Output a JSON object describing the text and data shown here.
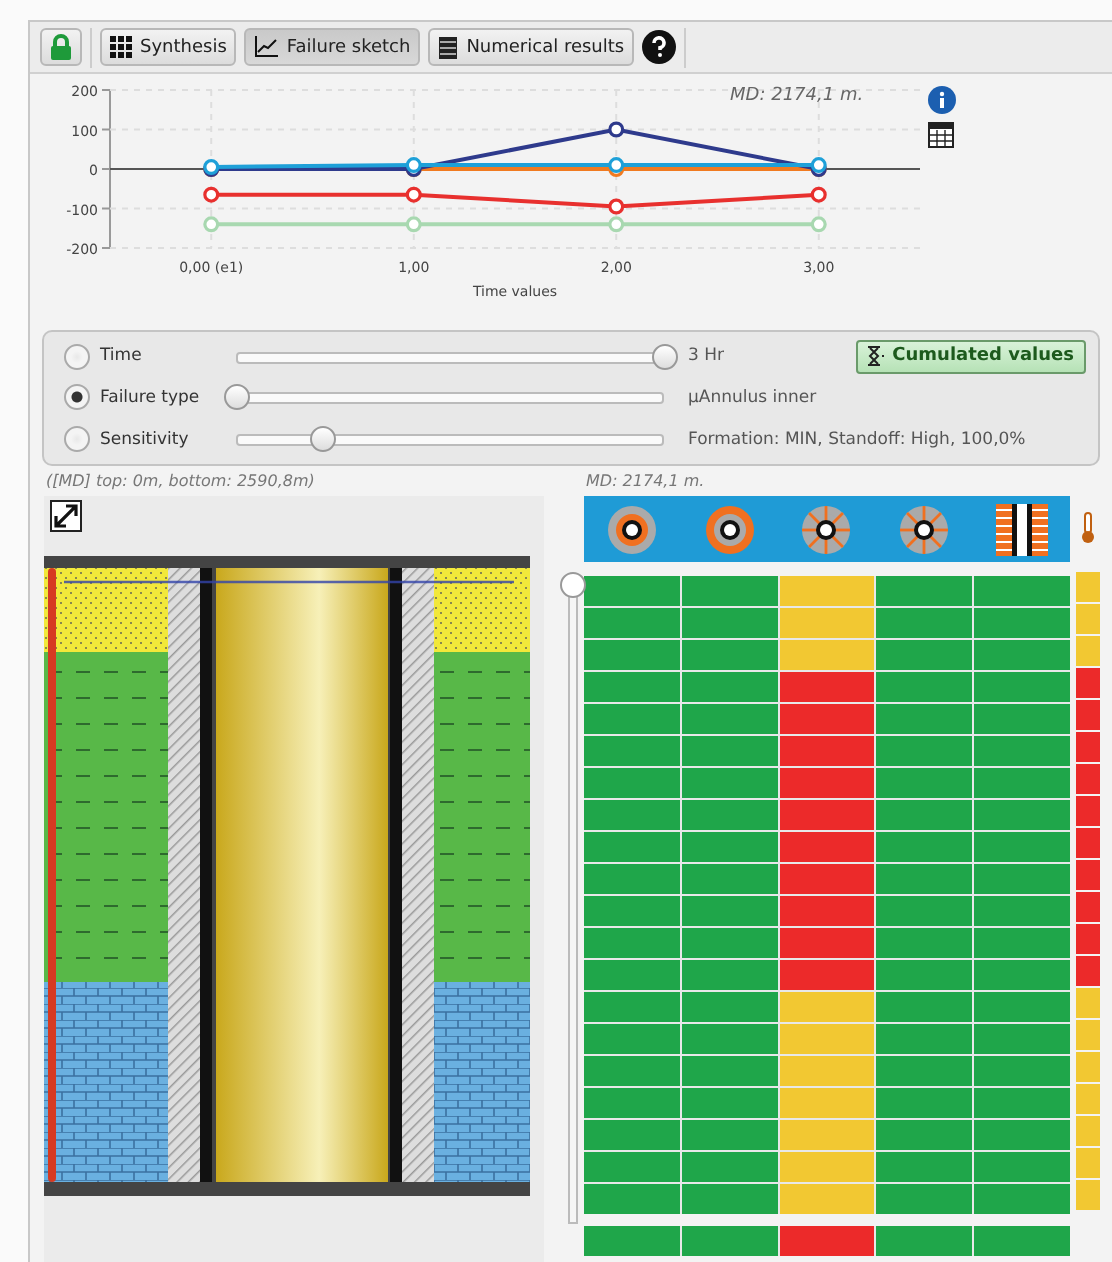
{
  "toolbar": {
    "buttons": [
      {
        "kind": "lock",
        "selected": false
      },
      {
        "kind": "grid",
        "label": "Synthesis",
        "selected": false
      },
      {
        "kind": "chart",
        "label": "Failure sketch",
        "selected": true
      },
      {
        "kind": "table",
        "label": "Numerical results",
        "selected": false
      },
      {
        "kind": "help",
        "selected": false
      }
    ]
  },
  "chart": {
    "md_label": "MD: 2174,1 m.",
    "chart_data": {
      "type": "line",
      "xlabel": "Time values",
      "x": [
        0,
        1,
        2,
        3
      ],
      "xlim": [
        -0.5,
        3.5
      ],
      "grid": true,
      "xticks": [
        {
          "value": 0,
          "label": "0,00 (e1)"
        },
        {
          "value": 1,
          "label": "1,00"
        },
        {
          "value": 2,
          "label": "2,00"
        },
        {
          "value": 3,
          "label": "3,00"
        }
      ],
      "ylim": [
        -200,
        200
      ],
      "yticks": [
        -200,
        -100,
        0,
        100,
        200
      ],
      "series": [
        {
          "color": "#a8d8b0",
          "marker": "circle",
          "values": [
            -140,
            -140,
            -140,
            -140
          ]
        },
        {
          "color": "#e8302e",
          "marker": "circle",
          "values": [
            -65,
            -65,
            -95,
            -65
          ]
        },
        {
          "color": "#f07a20",
          "marker": "circle",
          "values": [
            0,
            0,
            0,
            0
          ]
        },
        {
          "color": "#2e3a8c",
          "marker": "circle",
          "values": [
            0,
            0,
            100,
            0
          ]
        },
        {
          "color": "#1ea0d8",
          "marker": "circle",
          "values": [
            5,
            10,
            10,
            10
          ]
        }
      ]
    }
  },
  "controls": {
    "options": [
      {
        "label": "Time",
        "selected": false,
        "level": 1.0,
        "reading": "3 Hr"
      },
      {
        "label": "Failure type",
        "selected": true,
        "level": 0.0,
        "reading": "µAnnulus inner"
      },
      {
        "label": "Sensitivity",
        "selected": false,
        "level": 0.2,
        "reading": "Formation: MIN, Standoff: High, 100,0%"
      }
    ],
    "cumulated_button": "Cumulated values"
  },
  "left_caption": "([MD] top: 0m, bottom: 2590,8m)",
  "right_caption": "MD: 2174,1 m.",
  "depth_slider": {
    "level": 0.0
  },
  "grid": {
    "rows": [
      {
        "cells": [
          {
            "color": "#1fa64a"
          },
          {
            "color": "#1fa64a"
          },
          {
            "color": "#f2c832"
          },
          {
            "color": "#1fa64a"
          },
          {
            "color": "#1fa64a"
          }
        ],
        "strip": {
          "color": "#f2c832"
        }
      },
      {
        "cells": [
          {
            "color": "#1fa64a"
          },
          {
            "color": "#1fa64a"
          },
          {
            "color": "#f2c832"
          },
          {
            "color": "#1fa64a"
          },
          {
            "color": "#1fa64a"
          }
        ],
        "strip": {
          "color": "#f2c832"
        }
      },
      {
        "cells": [
          {
            "color": "#1fa64a"
          },
          {
            "color": "#1fa64a"
          },
          {
            "color": "#f2c832"
          },
          {
            "color": "#1fa64a"
          },
          {
            "color": "#1fa64a"
          }
        ],
        "strip": {
          "color": "#f2c832"
        }
      },
      {
        "cells": [
          {
            "color": "#1fa64a"
          },
          {
            "color": "#1fa64a"
          },
          {
            "color": "#ec2a2a"
          },
          {
            "color": "#1fa64a"
          },
          {
            "color": "#1fa64a"
          }
        ],
        "strip": {
          "color": "#ec2a2a"
        }
      },
      {
        "cells": [
          {
            "color": "#1fa64a"
          },
          {
            "color": "#1fa64a"
          },
          {
            "color": "#ec2a2a"
          },
          {
            "color": "#1fa64a"
          },
          {
            "color": "#1fa64a"
          }
        ],
        "strip": {
          "color": "#ec2a2a"
        }
      },
      {
        "cells": [
          {
            "color": "#1fa64a"
          },
          {
            "color": "#1fa64a"
          },
          {
            "color": "#ec2a2a"
          },
          {
            "color": "#1fa64a"
          },
          {
            "color": "#1fa64a"
          }
        ],
        "strip": {
          "color": "#ec2a2a"
        }
      },
      {
        "cells": [
          {
            "color": "#1fa64a"
          },
          {
            "color": "#1fa64a"
          },
          {
            "color": "#ec2a2a"
          },
          {
            "color": "#1fa64a"
          },
          {
            "color": "#1fa64a"
          }
        ],
        "strip": {
          "color": "#ec2a2a"
        }
      },
      {
        "cells": [
          {
            "color": "#1fa64a"
          },
          {
            "color": "#1fa64a"
          },
          {
            "color": "#ec2a2a"
          },
          {
            "color": "#1fa64a"
          },
          {
            "color": "#1fa64a"
          }
        ],
        "strip": {
          "color": "#ec2a2a"
        }
      },
      {
        "cells": [
          {
            "color": "#1fa64a"
          },
          {
            "color": "#1fa64a"
          },
          {
            "color": "#ec2a2a"
          },
          {
            "color": "#1fa64a"
          },
          {
            "color": "#1fa64a"
          }
        ],
        "strip": {
          "color": "#ec2a2a"
        }
      },
      {
        "cells": [
          {
            "color": "#1fa64a"
          },
          {
            "color": "#1fa64a"
          },
          {
            "color": "#ec2a2a"
          },
          {
            "color": "#1fa64a"
          },
          {
            "color": "#1fa64a"
          }
        ],
        "strip": {
          "color": "#ec2a2a"
        }
      },
      {
        "cells": [
          {
            "color": "#1fa64a"
          },
          {
            "color": "#1fa64a"
          },
          {
            "color": "#ec2a2a"
          },
          {
            "color": "#1fa64a"
          },
          {
            "color": "#1fa64a"
          }
        ],
        "strip": {
          "color": "#ec2a2a"
        }
      },
      {
        "cells": [
          {
            "color": "#1fa64a"
          },
          {
            "color": "#1fa64a"
          },
          {
            "color": "#ec2a2a"
          },
          {
            "color": "#1fa64a"
          },
          {
            "color": "#1fa64a"
          }
        ],
        "strip": {
          "color": "#ec2a2a"
        }
      },
      {
        "cells": [
          {
            "color": "#1fa64a"
          },
          {
            "color": "#1fa64a"
          },
          {
            "color": "#ec2a2a"
          },
          {
            "color": "#1fa64a"
          },
          {
            "color": "#1fa64a"
          }
        ],
        "strip": {
          "color": "#ec2a2a"
        }
      },
      {
        "cells": [
          {
            "color": "#1fa64a"
          },
          {
            "color": "#1fa64a"
          },
          {
            "color": "#f2c832"
          },
          {
            "color": "#1fa64a"
          },
          {
            "color": "#1fa64a"
          }
        ],
        "strip": {
          "color": "#f2c832"
        }
      },
      {
        "cells": [
          {
            "color": "#1fa64a"
          },
          {
            "color": "#1fa64a"
          },
          {
            "color": "#f2c832"
          },
          {
            "color": "#1fa64a"
          },
          {
            "color": "#1fa64a"
          }
        ],
        "strip": {
          "color": "#f2c832"
        }
      },
      {
        "cells": [
          {
            "color": "#1fa64a"
          },
          {
            "color": "#1fa64a"
          },
          {
            "color": "#f2c832"
          },
          {
            "color": "#1fa64a"
          },
          {
            "color": "#1fa64a"
          }
        ],
        "strip": {
          "color": "#f2c832"
        }
      },
      {
        "cells": [
          {
            "color": "#1fa64a"
          },
          {
            "color": "#1fa64a"
          },
          {
            "color": "#f2c832"
          },
          {
            "color": "#1fa64a"
          },
          {
            "color": "#1fa64a"
          }
        ],
        "strip": {
          "color": "#f2c832"
        }
      },
      {
        "cells": [
          {
            "color": "#1fa64a"
          },
          {
            "color": "#1fa64a"
          },
          {
            "color": "#f2c832"
          },
          {
            "color": "#1fa64a"
          },
          {
            "color": "#1fa64a"
          }
        ],
        "strip": {
          "color": "#f2c832"
        }
      },
      {
        "cells": [
          {
            "color": "#1fa64a"
          },
          {
            "color": "#1fa64a"
          },
          {
            "color": "#f2c832"
          },
          {
            "color": "#1fa64a"
          },
          {
            "color": "#1fa64a"
          }
        ],
        "strip": {
          "color": "#f2c832"
        }
      },
      {
        "cells": [
          {
            "color": "#1fa64a"
          },
          {
            "color": "#1fa64a"
          },
          {
            "color": "#f2c832"
          },
          {
            "color": "#1fa64a"
          },
          {
            "color": "#1fa64a"
          }
        ],
        "strip": {
          "color": "#f2c832"
        }
      }
    ],
    "footer_row": {
      "cells": [
        {
          "color": "#1fa64a"
        },
        {
          "color": "#1fa64a"
        },
        {
          "color": "#ec2a2a"
        },
        {
          "color": "#1fa64a"
        },
        {
          "color": "#1fa64a"
        }
      ]
    }
  }
}
